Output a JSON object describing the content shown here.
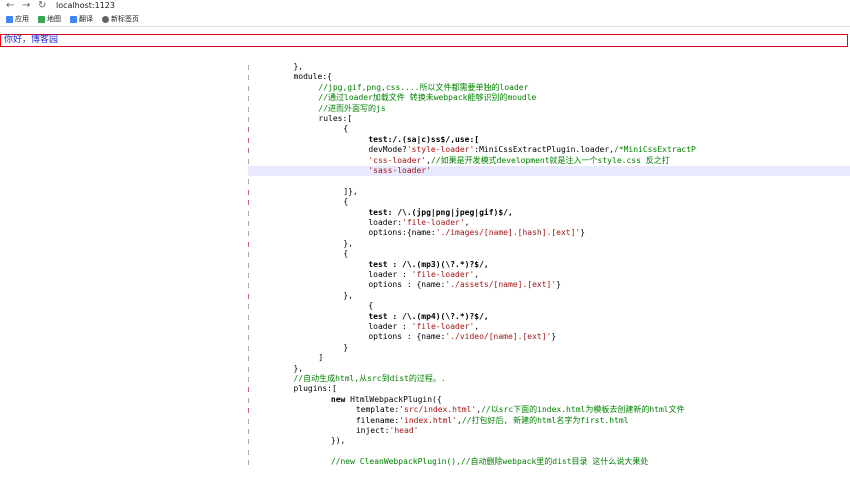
{
  "browser": {
    "url": "localhost:1123",
    "bookmarks": [
      {
        "label": "应用",
        "icon": "apps-icon",
        "color": "#4285f4"
      },
      {
        "label": "地图",
        "icon": "maps-icon",
        "color": "#34a853"
      },
      {
        "label": "翻译",
        "icon": "translate-icon",
        "color": "#4285f4"
      },
      {
        "label": "新标签页",
        "icon": "newtab-icon",
        "color": "#5f6368"
      }
    ]
  },
  "page": {
    "greeting": "你好，博客园"
  },
  "code": [
    {
      "indent": 3,
      "parts": [
        {
          "t": "},",
          "c": ""
        }
      ]
    },
    {
      "indent": 3,
      "parts": [
        {
          "t": "module:{",
          "c": ""
        }
      ]
    },
    {
      "indent": 5,
      "parts": [
        {
          "t": "//jpg,gif,png,css....所以文件都需要单独的loader",
          "c": "c"
        }
      ]
    },
    {
      "indent": 5,
      "parts": [
        {
          "t": "//通过loader加载文件 转换未webpack能够识别的moudle",
          "c": "c"
        }
      ]
    },
    {
      "indent": 5,
      "parts": [
        {
          "t": "//进而外面写的js",
          "c": "c"
        }
      ]
    },
    {
      "indent": 5,
      "parts": [
        {
          "t": "rules:[",
          "c": ""
        }
      ]
    },
    {
      "indent": 7,
      "parts": [
        {
          "t": "{",
          "c": ""
        }
      ]
    },
    {
      "indent": 9,
      "parts": [
        {
          "t": "test:/.(sa|c)ss$/,use:[",
          "c": "k"
        }
      ]
    },
    {
      "indent": 9,
      "parts": [
        {
          "t": "devMode?",
          "c": ""
        },
        {
          "t": "'style-loader'",
          "c": "s"
        },
        {
          "t": ":MiniCssExtractPlugin.loader,",
          "c": ""
        },
        {
          "t": "/*MiniCssExtractP",
          "c": "c"
        }
      ]
    },
    {
      "indent": 9,
      "parts": [
        {
          "t": "'css-loader'",
          "c": "s"
        },
        {
          "t": ",",
          "c": ""
        },
        {
          "t": "//如果是开发模式development就是注入一个style.css 反之打",
          "c": "c"
        }
      ]
    },
    {
      "indent": 9,
      "parts": [
        {
          "t": "'sass-loader'",
          "c": "s"
        }
      ],
      "hl": true
    },
    {
      "indent": 0,
      "parts": []
    },
    {
      "indent": 7,
      "parts": [
        {
          "t": "]},",
          "c": ""
        }
      ]
    },
    {
      "indent": 7,
      "parts": [
        {
          "t": "{",
          "c": ""
        }
      ]
    },
    {
      "indent": 9,
      "parts": [
        {
          "t": "test: /\\.(jpg|png|jpeg|gif)$/,",
          "c": "k"
        }
      ]
    },
    {
      "indent": 9,
      "parts": [
        {
          "t": "loader:",
          "c": ""
        },
        {
          "t": "'file-loader'",
          "c": "s"
        },
        {
          "t": ",",
          "c": ""
        }
      ]
    },
    {
      "indent": 9,
      "parts": [
        {
          "t": "options:{name:",
          "c": ""
        },
        {
          "t": "'./images/[name].[hash].[ext]'",
          "c": "s"
        },
        {
          "t": "}",
          "c": ""
        }
      ]
    },
    {
      "indent": 7,
      "parts": [
        {
          "t": "},",
          "c": ""
        }
      ]
    },
    {
      "indent": 7,
      "parts": [
        {
          "t": "{",
          "c": ""
        }
      ]
    },
    {
      "indent": 9,
      "parts": [
        {
          "t": "test : /\\.(mp3)(\\?.*)?$/,",
          "c": "k"
        }
      ]
    },
    {
      "indent": 9,
      "parts": [
        {
          "t": "loader : ",
          "c": ""
        },
        {
          "t": "'file-loader'",
          "c": "s"
        },
        {
          "t": ",",
          "c": ""
        }
      ]
    },
    {
      "indent": 9,
      "parts": [
        {
          "t": "options : {name:",
          "c": ""
        },
        {
          "t": "'./assets/[name].[ext]'",
          "c": "s"
        },
        {
          "t": "}",
          "c": ""
        }
      ]
    },
    {
      "indent": 7,
      "parts": [
        {
          "t": "},",
          "c": ""
        }
      ]
    },
    {
      "indent": 9,
      "parts": [
        {
          "t": "{",
          "c": ""
        }
      ]
    },
    {
      "indent": 9,
      "parts": [
        {
          "t": "test : /\\.(mp4)(\\?.*)?$/,",
          "c": "k"
        }
      ]
    },
    {
      "indent": 9,
      "parts": [
        {
          "t": "loader : ",
          "c": ""
        },
        {
          "t": "'file-loader'",
          "c": "s"
        },
        {
          "t": ",",
          "c": ""
        }
      ]
    },
    {
      "indent": 9,
      "parts": [
        {
          "t": "options : {name:",
          "c": ""
        },
        {
          "t": "'./video/[name].[ext]'",
          "c": "s"
        },
        {
          "t": "}",
          "c": ""
        }
      ]
    },
    {
      "indent": 7,
      "parts": [
        {
          "t": "}",
          "c": ""
        }
      ]
    },
    {
      "indent": 5,
      "parts": [
        {
          "t": "]",
          "c": ""
        }
      ]
    },
    {
      "indent": 3,
      "parts": [
        {
          "t": "},",
          "c": ""
        }
      ]
    },
    {
      "indent": 3,
      "parts": [
        {
          "t": "//自动生成html,从src到dist的过程。.",
          "c": "c"
        }
      ]
    },
    {
      "indent": 3,
      "parts": [
        {
          "t": "plugins:[",
          "c": ""
        }
      ]
    },
    {
      "indent": 6,
      "parts": [
        {
          "t": "new ",
          "c": "k"
        },
        {
          "t": "HtmlWebpackPlugin({",
          "c": ""
        }
      ]
    },
    {
      "indent": 8,
      "parts": [
        {
          "t": "template:",
          "c": ""
        },
        {
          "t": "'src/index.html'",
          "c": "s"
        },
        {
          "t": ",",
          "c": ""
        },
        {
          "t": "//以src下面的index.html为模板去创建新的html文件",
          "c": "c"
        }
      ]
    },
    {
      "indent": 8,
      "parts": [
        {
          "t": "filename:",
          "c": ""
        },
        {
          "t": "'index.html'",
          "c": "s"
        },
        {
          "t": ",",
          "c": ""
        },
        {
          "t": "//打包好后, 新建的html名字为first.html",
          "c": "c"
        }
      ]
    },
    {
      "indent": 8,
      "parts": [
        {
          "t": "inject:",
          "c": ""
        },
        {
          "t": "'head'",
          "c": "s"
        }
      ]
    },
    {
      "indent": 6,
      "parts": [
        {
          "t": "}),",
          "c": ""
        }
      ]
    },
    {
      "indent": 0,
      "parts": []
    },
    {
      "indent": 6,
      "parts": [
        {
          "t": "//new CleanWebpackPlugin(),//自动删除webpack里的dist目录 这什么说大果处",
          "c": "c"
        }
      ]
    }
  ]
}
